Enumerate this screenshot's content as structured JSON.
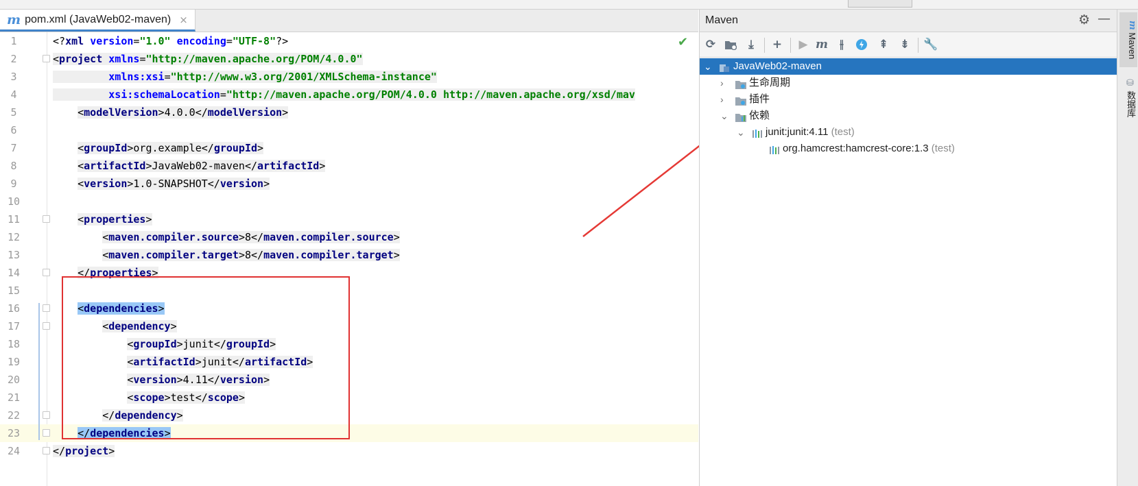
{
  "editor_tab": {
    "icon": "maven-m-icon",
    "glyph": "m",
    "label": "pom.xml (JavaWeb02-maven)",
    "close": "×"
  },
  "line_numbers": [
    "1",
    "2",
    "3",
    "4",
    "5",
    "6",
    "7",
    "8",
    "9",
    "10",
    "11",
    "12",
    "13",
    "14",
    "15",
    "16",
    "17",
    "18",
    "19",
    "20",
    "21",
    "22",
    "23",
    "24"
  ],
  "code": {
    "l1": {
      "open": "<?",
      "name": "xml",
      "a1": "version",
      "eq": "=",
      "v1": "\"1.0\"",
      "a2": "encoding",
      "v2": "\"UTF-8\"",
      "close": "?>"
    },
    "l2": {
      "tag": "project",
      "attr": "xmlns",
      "val": "\"http://maven.apache.org/POM/4.0.0\""
    },
    "l3": {
      "attr": "xmlns:xsi",
      "val": "\"http://www.w3.org/2001/XMLSchema-instance\""
    },
    "l4": {
      "attr": "xsi:schemaLocation",
      "val": "\"http://maven.apache.org/POM/4.0.0 http://maven.apache.org/xsd/mav"
    },
    "l5": {
      "tag": "modelVersion",
      "text": "4.0.0"
    },
    "l7": {
      "tag": "groupId",
      "text": "org.example"
    },
    "l8": {
      "tag": "artifactId",
      "text": "JavaWeb02-maven"
    },
    "l9": {
      "tag": "version",
      "text": "1.0-SNAPSHOT"
    },
    "l11": {
      "tag": "properties"
    },
    "l12": {
      "tag": "maven.compiler.source",
      "text": "8"
    },
    "l13": {
      "tag": "maven.compiler.target",
      "text": "8"
    },
    "l14": {
      "tag": "properties"
    },
    "l16": {
      "tag": "dependencies"
    },
    "l17": {
      "tag": "dependency"
    },
    "l18": {
      "tag": "groupId",
      "text": "junit"
    },
    "l19": {
      "tag": "artifactId",
      "text": "junit"
    },
    "l20": {
      "tag": "version",
      "text": "4.11"
    },
    "l21": {
      "tag": "scope",
      "text": "test"
    },
    "l22": {
      "tag": "dependency"
    },
    "l23": {
      "tag": "dependencies"
    },
    "l24": {
      "tag": "project"
    }
  },
  "maven_panel": {
    "title": "Maven",
    "header_icons": [
      "gear-icon",
      "minimize-icon"
    ],
    "toolbar": [
      "reload-icon",
      "add-folder-icon",
      "download-icon",
      "plus-icon",
      "run-icon",
      "maven-m-icon",
      "toggle-offline-icon",
      "lightning-icon",
      "expand-all-icon",
      "collapse-all-icon",
      "wrench-icon"
    ],
    "tree": {
      "root": "JavaWeb02-maven",
      "lifecycle": "生命周期",
      "plugins": "插件",
      "dependencies": "依赖",
      "dep1": "junit:junit:4.11",
      "dep1_scope": "(test)",
      "dep2": "org.hamcrest:hamcrest-core:1.3",
      "dep2_scope": "(test)"
    }
  },
  "side_tabs": {
    "maven": "Maven",
    "database": "数据库"
  },
  "colors": {
    "selection": "#2675bf",
    "annotation": "#e03131",
    "tag": "#000080",
    "string": "#008000",
    "attr": "#0000ff"
  }
}
